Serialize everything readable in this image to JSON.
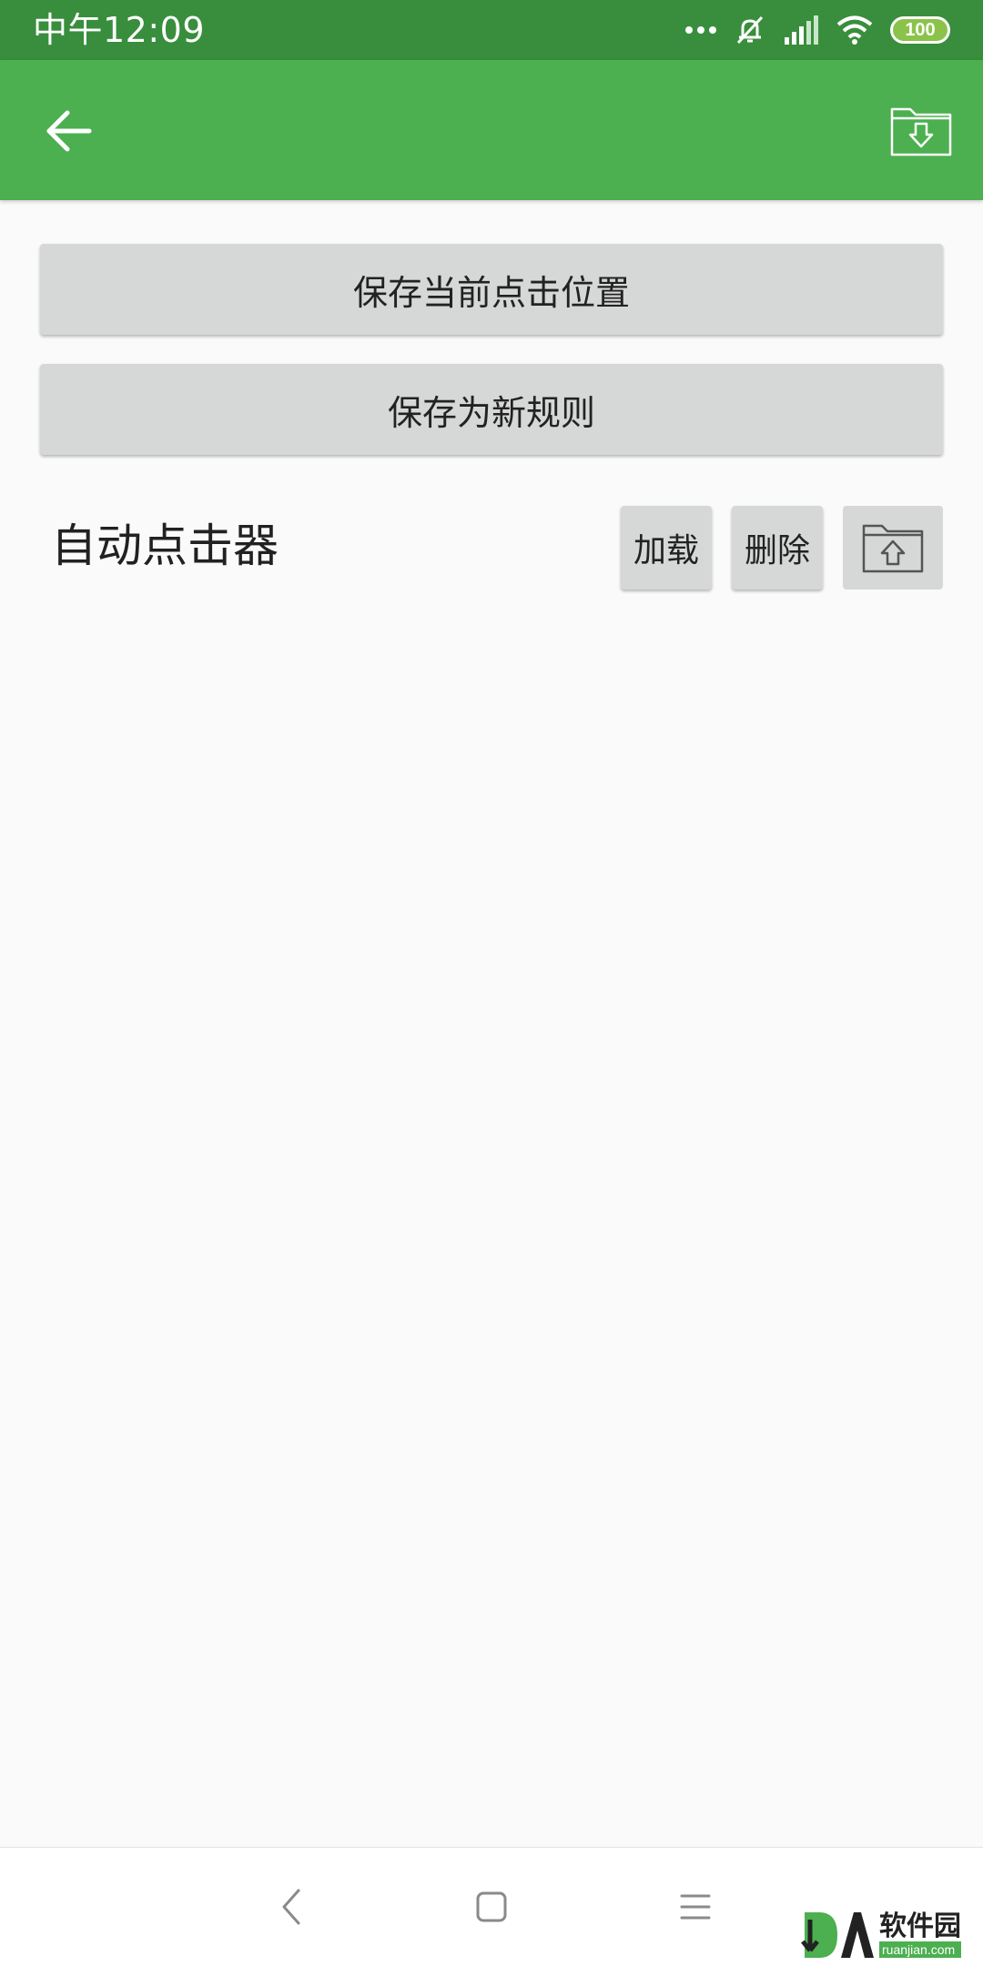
{
  "status_bar": {
    "time": "中午12:09",
    "battery": "100"
  },
  "app_bar": {
    "back_icon": "arrow-back-icon",
    "import_icon": "folder-download-icon"
  },
  "actions": {
    "save_position": "保存当前点击位置",
    "save_rule": "保存为新规则"
  },
  "rules": [
    {
      "name": "自动点击器",
      "load_label": "加载",
      "delete_label": "删除",
      "export_icon": "folder-upload-icon"
    }
  ],
  "watermark": {
    "text_cn": "软件园",
    "text_en": "ruanjian.com"
  },
  "colors": {
    "status_bar": "#388e3c",
    "app_bar": "#4caf50",
    "button_bg": "#d6d7d7",
    "background": "#fafafa"
  }
}
